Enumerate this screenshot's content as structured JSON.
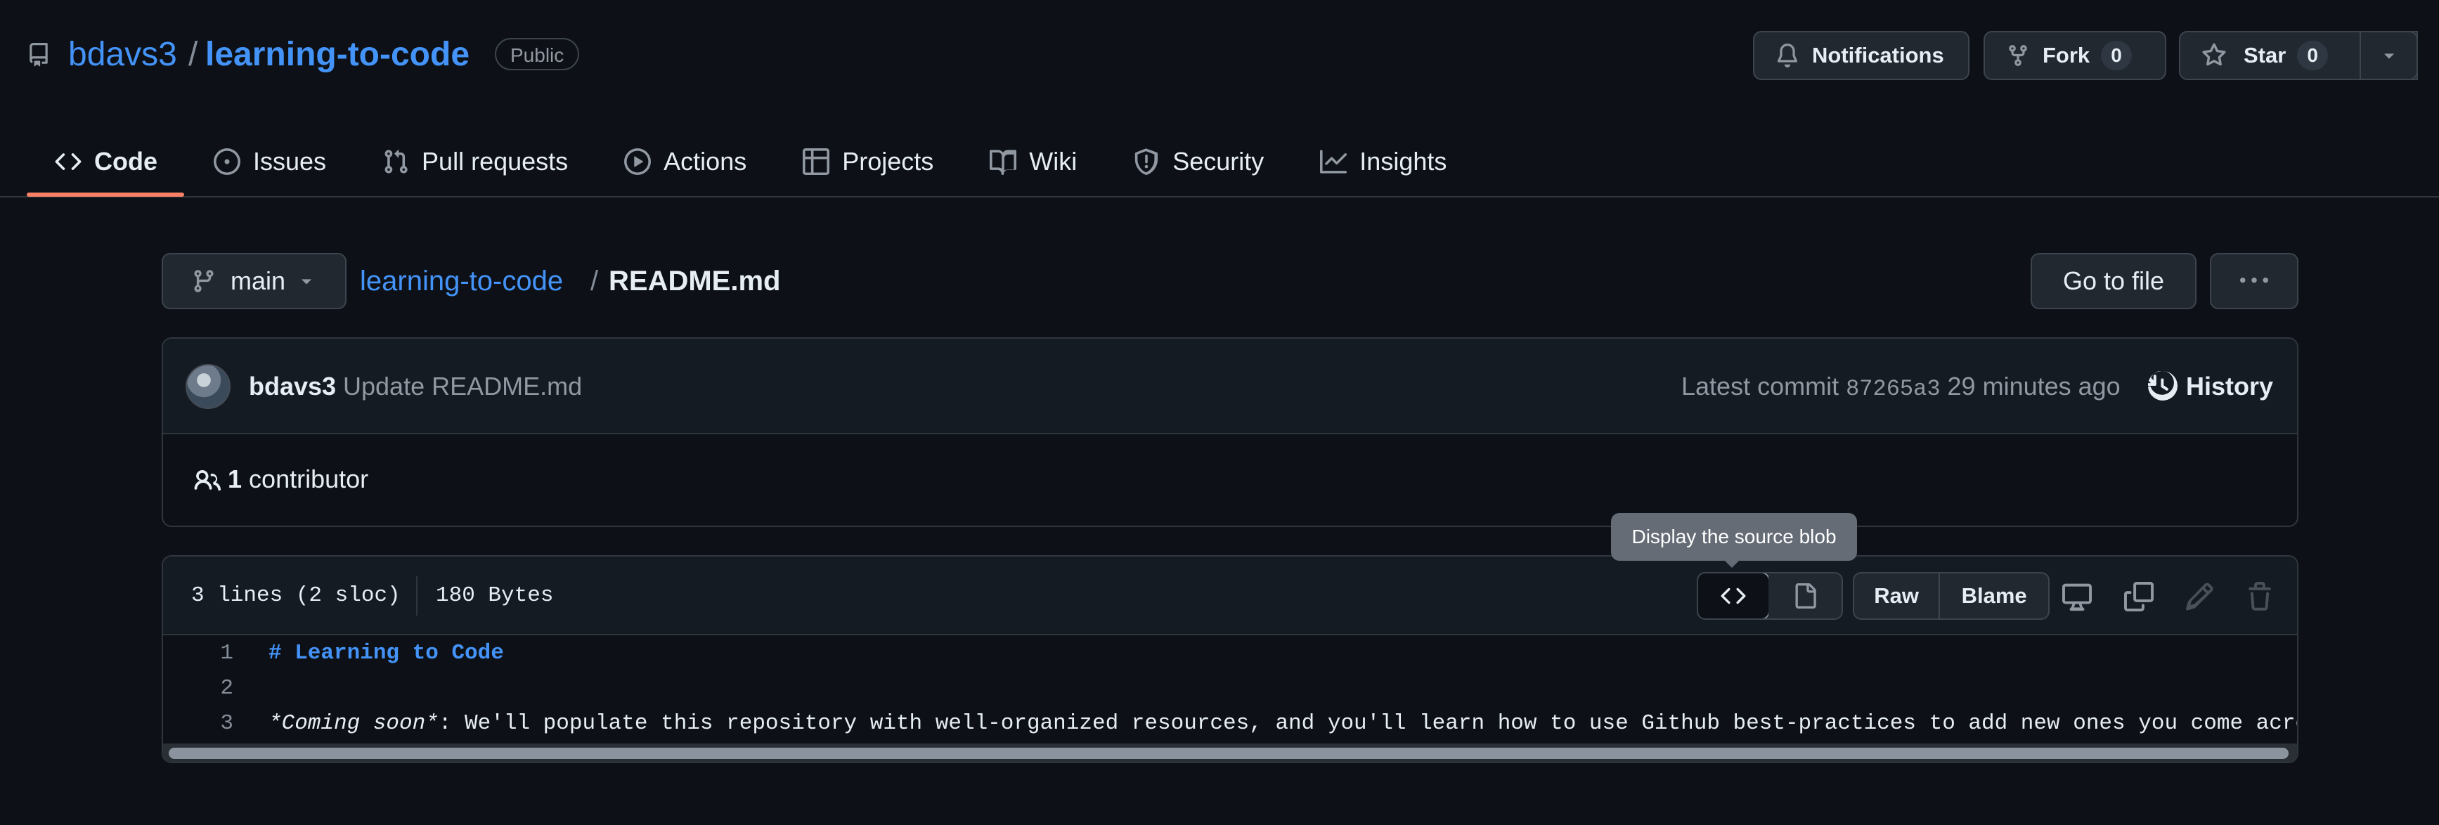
{
  "repo": {
    "owner": "bdavs3",
    "separator": "/",
    "name": "learning-to-code",
    "visibility": "Public"
  },
  "actions": {
    "notifications_label": "Notifications",
    "fork_label": "Fork",
    "fork_count": "0",
    "star_label": "Star",
    "star_count": "0"
  },
  "tabs": [
    {
      "label": "Code",
      "icon": "code-icon",
      "active": true
    },
    {
      "label": "Issues",
      "icon": "issue-icon"
    },
    {
      "label": "Pull requests",
      "icon": "pull-request-icon"
    },
    {
      "label": "Actions",
      "icon": "play-icon"
    },
    {
      "label": "Projects",
      "icon": "table-icon"
    },
    {
      "label": "Wiki",
      "icon": "book-icon"
    },
    {
      "label": "Security",
      "icon": "shield-icon"
    },
    {
      "label": "Insights",
      "icon": "graph-icon"
    }
  ],
  "breadcrumb": {
    "branch": "main",
    "repo": "learning-to-code",
    "separator": "/",
    "file": "README.md"
  },
  "file_actions": {
    "goto_label": "Go to file",
    "more_label": "···"
  },
  "commit": {
    "author": "bdavs3",
    "message": "Update README.md",
    "latest_label": "Latest commit",
    "sha": "87265a3",
    "time": "29 minutes ago",
    "history_label": "History",
    "contributors_count": "1",
    "contributors_label": "contributor"
  },
  "file": {
    "lines_info": "3 lines (2 sloc)",
    "size": "180 Bytes",
    "raw_label": "Raw",
    "blame_label": "Blame",
    "tooltip": "Display the source blob",
    "code_lines": [
      {
        "num": "1",
        "heading": "# Learning to Code"
      },
      {
        "num": "2"
      },
      {
        "num": "3",
        "emph": "*Coming soon*",
        "rest": ": We'll populate this repository with well-organized resources, and you'll learn how to use Github best-practices to add new ones you come across!"
      }
    ]
  },
  "colors": {
    "accent": "#4493f8",
    "tab_underline": "#f78166",
    "background": "#0d1117"
  }
}
